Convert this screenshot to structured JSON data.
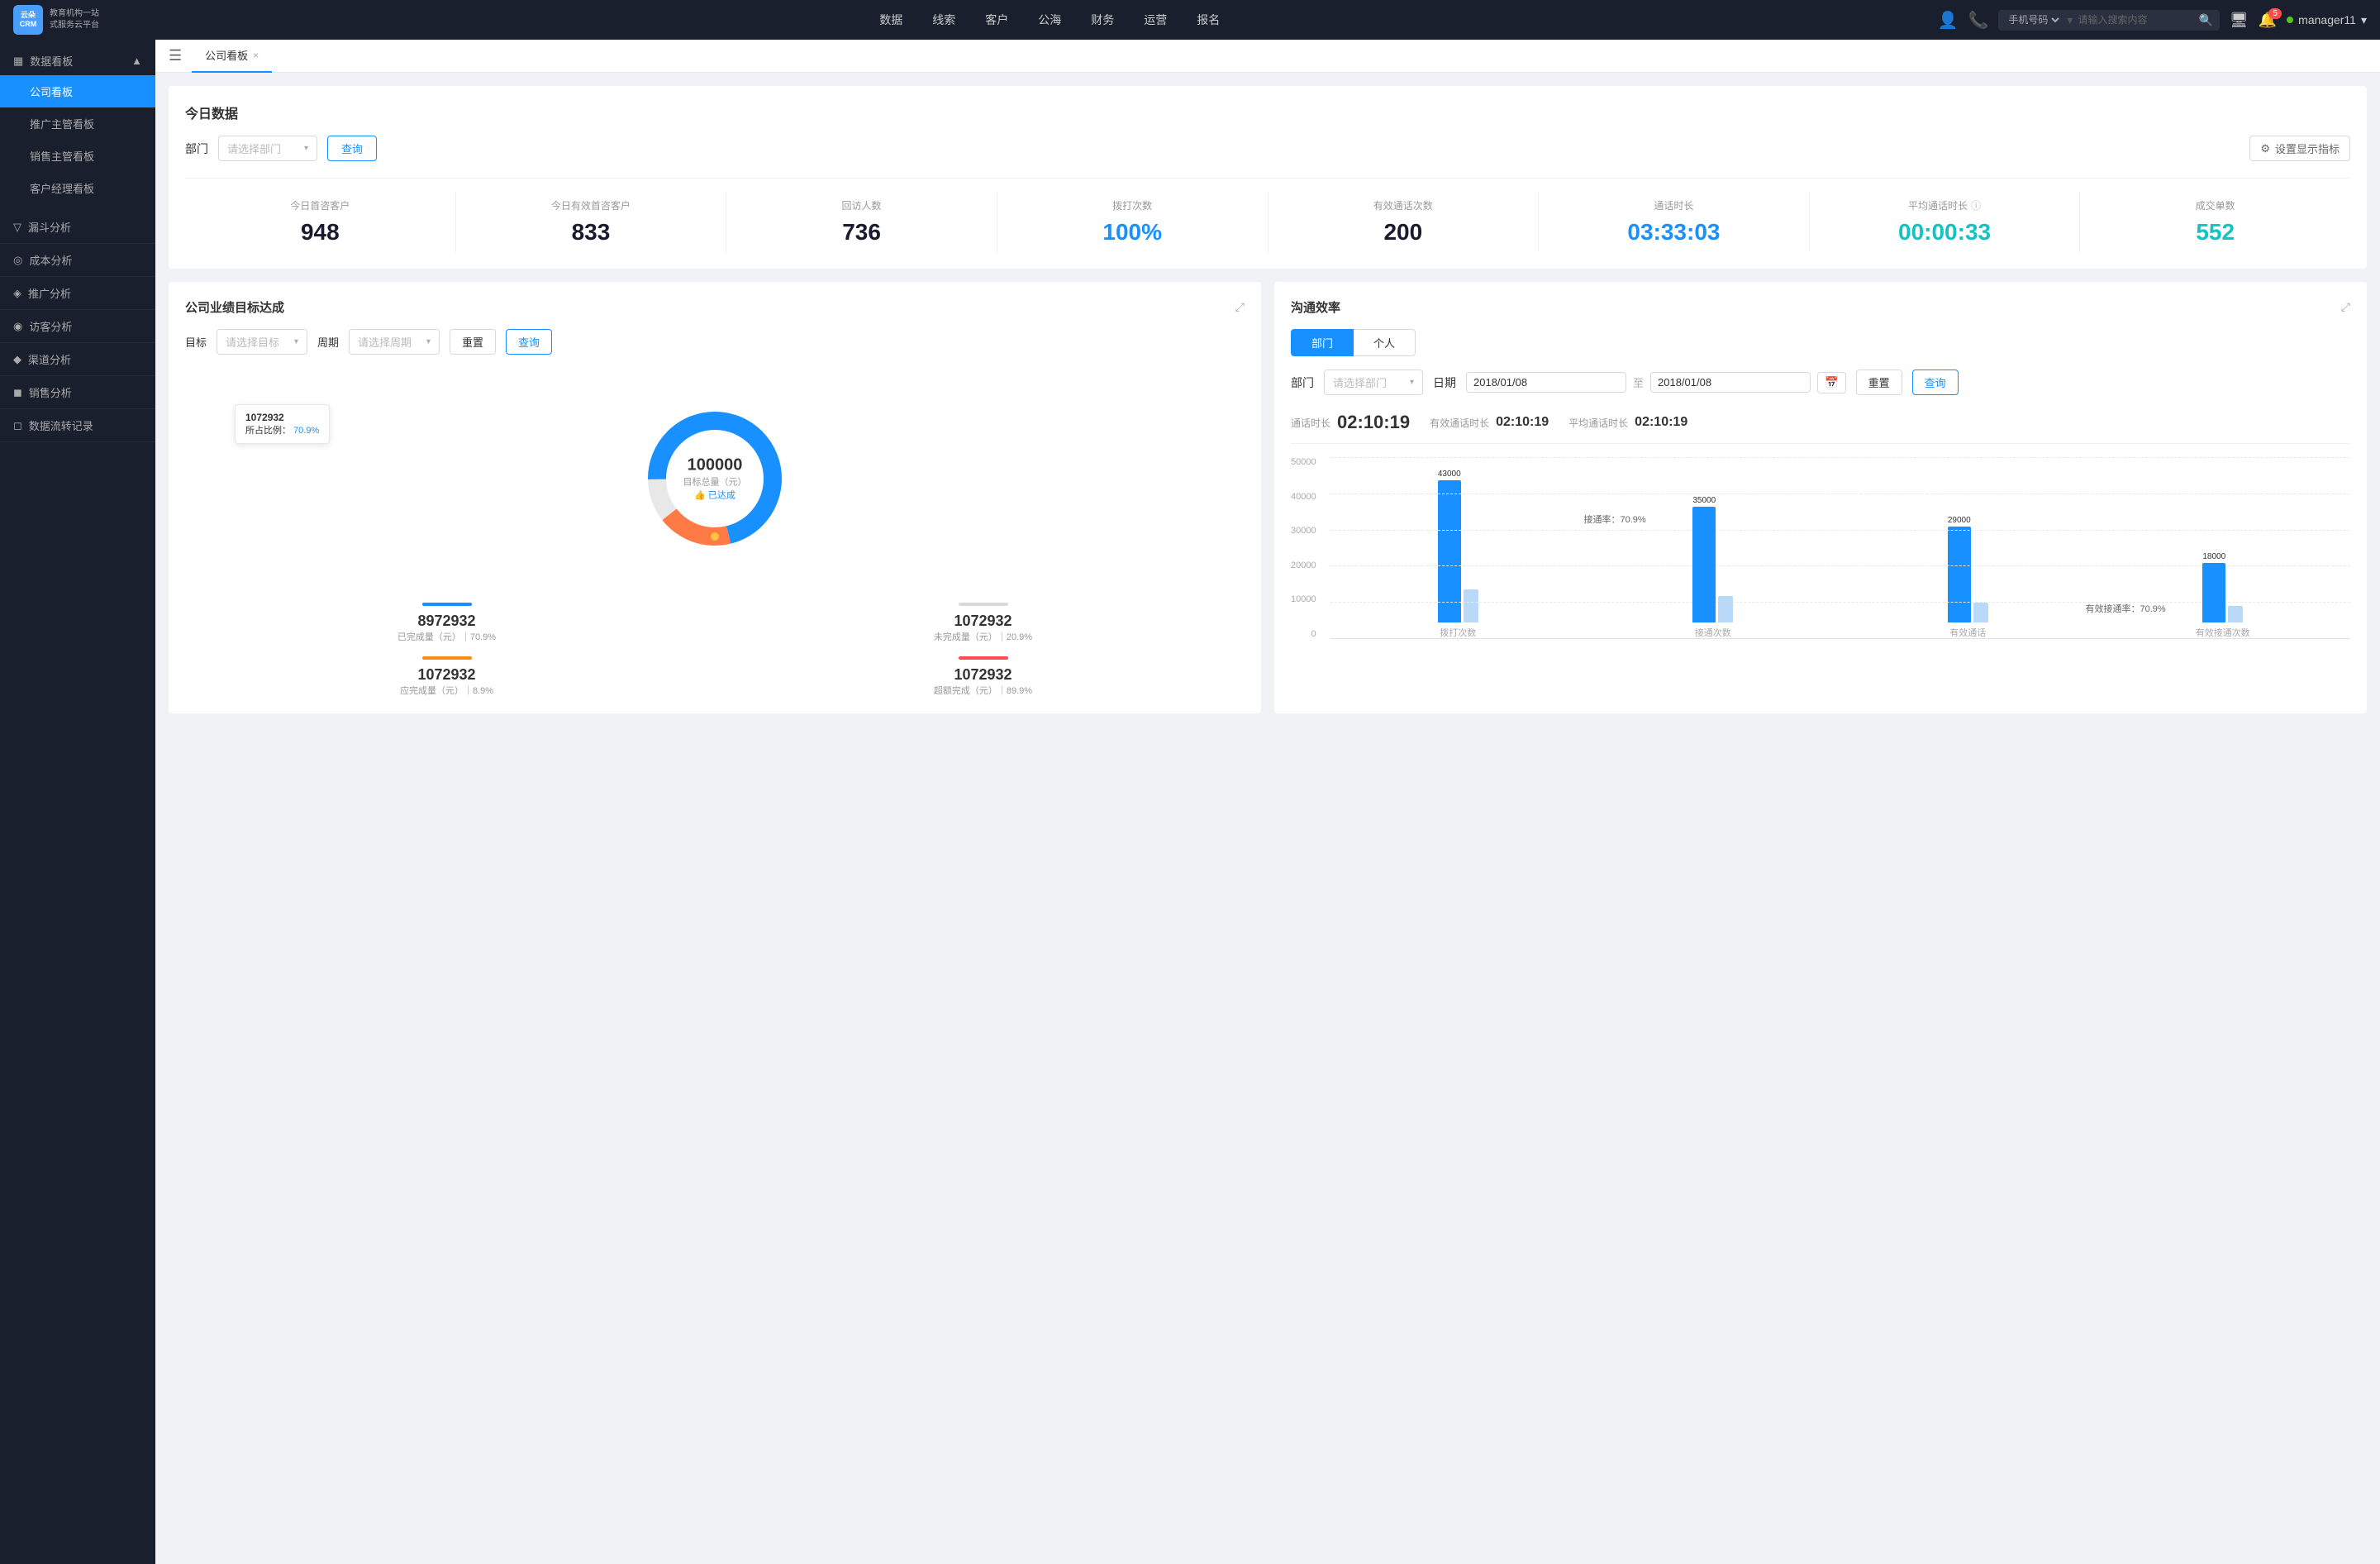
{
  "topNav": {
    "logo": {
      "text1": "云朵CRM",
      "text2": "教育机构一站\n式服务云平台"
    },
    "items": [
      "数据",
      "线索",
      "客户",
      "公海",
      "财务",
      "运营",
      "报名"
    ],
    "search": {
      "selectLabel": "手机号码",
      "placeholder": "请输入搜索内容"
    },
    "notifications": "5",
    "username": "manager11"
  },
  "sidebar": {
    "headerLabel": "数据看板",
    "activeItem": "公司看板",
    "items": [
      {
        "label": "公司看板",
        "active": true
      },
      {
        "label": "推广主管看板",
        "active": false
      },
      {
        "label": "销售主管看板",
        "active": false
      },
      {
        "label": "客户经理看板",
        "active": false
      }
    ],
    "groups": [
      {
        "label": "漏斗分析",
        "icon": "▽"
      },
      {
        "label": "成本分析",
        "icon": "◎"
      },
      {
        "label": "推广分析",
        "icon": "◈"
      },
      {
        "label": "访客分析",
        "icon": "◉"
      },
      {
        "label": "渠道分析",
        "icon": "◆"
      },
      {
        "label": "销售分析",
        "icon": "◼"
      },
      {
        "label": "数据流转记录",
        "icon": "◻"
      }
    ]
  },
  "tabs": [
    {
      "label": "公司看板",
      "active": true
    }
  ],
  "today": {
    "title": "今日数据",
    "filterLabel": "部门",
    "selectPlaceholder": "请选择部门",
    "queryBtn": "查询",
    "settingsBtn": "设置显示指标",
    "metrics": [
      {
        "label": "今日首咨客户",
        "value": "948",
        "colorClass": "dark"
      },
      {
        "label": "今日有效首咨客户",
        "value": "833",
        "colorClass": "dark"
      },
      {
        "label": "回访人数",
        "value": "736",
        "colorClass": "dark"
      },
      {
        "label": "拨打次数",
        "value": "100%",
        "colorClass": "blue"
      },
      {
        "label": "有效通话次数",
        "value": "200",
        "colorClass": "dark"
      },
      {
        "label": "通话时长",
        "value": "03:33:03",
        "colorClass": "blue"
      },
      {
        "label": "平均通话时长",
        "value": "00:00:33",
        "colorClass": "cyan"
      },
      {
        "label": "成交单数",
        "value": "552",
        "colorClass": "teal"
      }
    ]
  },
  "goalPanel": {
    "title": "公司业绩目标达成",
    "goalLabel": "目标",
    "goalPlaceholder": "请选择目标",
    "periodLabel": "周期",
    "periodPlaceholder": "请选择周期",
    "resetBtn": "重置",
    "queryBtn": "查询",
    "tooltip": {
      "value": "1072932",
      "percentLabel": "所占比例：",
      "percent": "70.9%"
    },
    "donutCenter": {
      "number": "100000",
      "label": "目标总量（元）",
      "sublabel": "👍 已达成"
    },
    "stats": [
      {
        "value": "8972932",
        "desc": "已完成量（元）｜70.9%",
        "barColor": "blue"
      },
      {
        "value": "1072932",
        "desc": "未完成量（元）｜20.9%",
        "barColor": "gray"
      },
      {
        "value": "1072932",
        "desc": "应完成量（元）｜8.9%",
        "barColor": "orange"
      },
      {
        "value": "1072932",
        "desc": "超额完成（元）｜89.9%",
        "barColor": "red"
      }
    ]
  },
  "efficiencyPanel": {
    "title": "沟通效率",
    "tabs": [
      {
        "label": "部门",
        "active": true
      },
      {
        "label": "个人",
        "active": false
      }
    ],
    "deptLabel": "部门",
    "deptPlaceholder": "请选择部门",
    "dateLabel": "日期",
    "dateFrom": "2018/01/08",
    "dateTo": "2018/01/08",
    "resetBtn": "重置",
    "queryBtn": "查询",
    "timeStats": {
      "durationLabel": "通话时长",
      "durationValue": "02:10:19",
      "effectiveLabel": "有效通话时长",
      "effectiveValue": "02:10:19",
      "avgLabel": "平均通话时长",
      "avgValue": "02:10:19"
    },
    "chart": {
      "yAxis": [
        "50000",
        "40000",
        "30000",
        "20000",
        "10000",
        "0"
      ],
      "groups": [
        {
          "label": "拨打次数",
          "bars": [
            {
              "value": 43000,
              "label": "43000",
              "color": "#1890ff",
              "height": 170
            },
            {
              "value": 10000,
              "label": "",
              "color": "#d0e8ff",
              "height": 40
            }
          ]
        },
        {
          "label": "接通次数",
          "bars": [
            {
              "value": 35000,
              "label": "35000",
              "color": "#1890ff",
              "height": 140
            },
            {
              "value": 8000,
              "label": "",
              "color": "#d0e8ff",
              "height": 32
            }
          ],
          "rateLabel": "接通率：70.9%"
        },
        {
          "label": "有效通话",
          "bars": [
            {
              "value": 29000,
              "label": "29000",
              "color": "#1890ff",
              "height": 116
            },
            {
              "value": 6000,
              "label": "",
              "color": "#d0e8ff",
              "height": 24
            }
          ]
        },
        {
          "label": "有效接通次数",
          "bars": [
            {
              "value": 18000,
              "label": "18000",
              "color": "#1890ff",
              "height": 72
            },
            {
              "value": 5000,
              "label": "",
              "color": "#d0e8ff",
              "height": 20
            }
          ],
          "rateLabel": "有效接通率：70.9%"
        }
      ]
    }
  },
  "icons": {
    "search": "🔍",
    "bell": "🔔",
    "monitor": "🖥",
    "chevronDown": "▾",
    "hamburger": "☰",
    "close": "×",
    "settings": "⚙",
    "expand": "⤢",
    "info": "ⓘ",
    "calendar": "📅",
    "thumbsUp": "👍"
  }
}
